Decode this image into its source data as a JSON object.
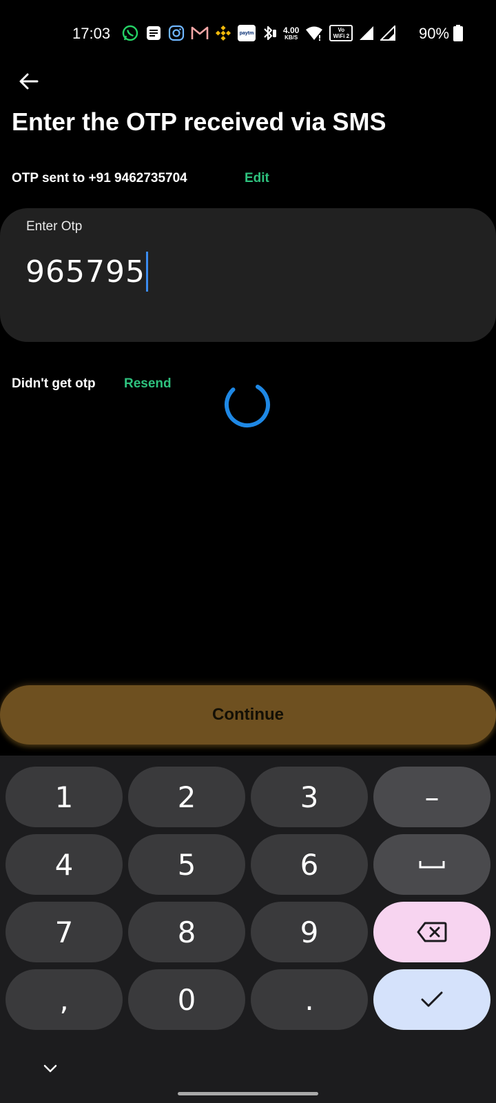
{
  "status_bar": {
    "time": "17:03",
    "net_speed_value": "4.00",
    "net_speed_unit": "KB/S",
    "paytm_label": "paytm",
    "volte_label": "Vo",
    "wifi_call_label": "WiFi 2",
    "battery_percent": "90%",
    "icons": [
      "whatsapp-icon",
      "messages-icon",
      "instagram-icon",
      "gmail-icon",
      "binance-icon",
      "paytm-icon",
      "bluetooth-icon",
      "wifi-icon",
      "volte-icon",
      "signal-icon",
      "signal-icon",
      "battery-icon"
    ]
  },
  "header": {
    "title": "Enter the OTP received via SMS",
    "otp_sent_text": "OTP sent to +91 9462735704",
    "edit_label": "Edit"
  },
  "otp_field": {
    "label": "Enter Otp",
    "value": "965795"
  },
  "resend": {
    "prompt": "Didn't get otp",
    "link_label": "Resend"
  },
  "continue_button": {
    "label": "Continue"
  },
  "keyboard": {
    "keys": [
      "1",
      "2",
      "3",
      "–",
      "4",
      "5",
      "6",
      "space",
      "7",
      "8",
      "9",
      "backspace",
      ",",
      "0",
      ".",
      "done"
    ],
    "row1": [
      "1",
      "2",
      "3"
    ],
    "row2": [
      "4",
      "5",
      "6"
    ],
    "row3": [
      "7",
      "8",
      "9"
    ],
    "row4": [
      ",",
      "0",
      "."
    ],
    "minus_label": "–"
  },
  "colors": {
    "accent_green": "#2ec27e",
    "continue_bg": "#6e5020",
    "caret_blue": "#3b8cf0",
    "spinner_blue": "#1e88e5",
    "backspace_key_bg": "#f7d4f0",
    "done_key_bg": "#d5e2fb"
  }
}
